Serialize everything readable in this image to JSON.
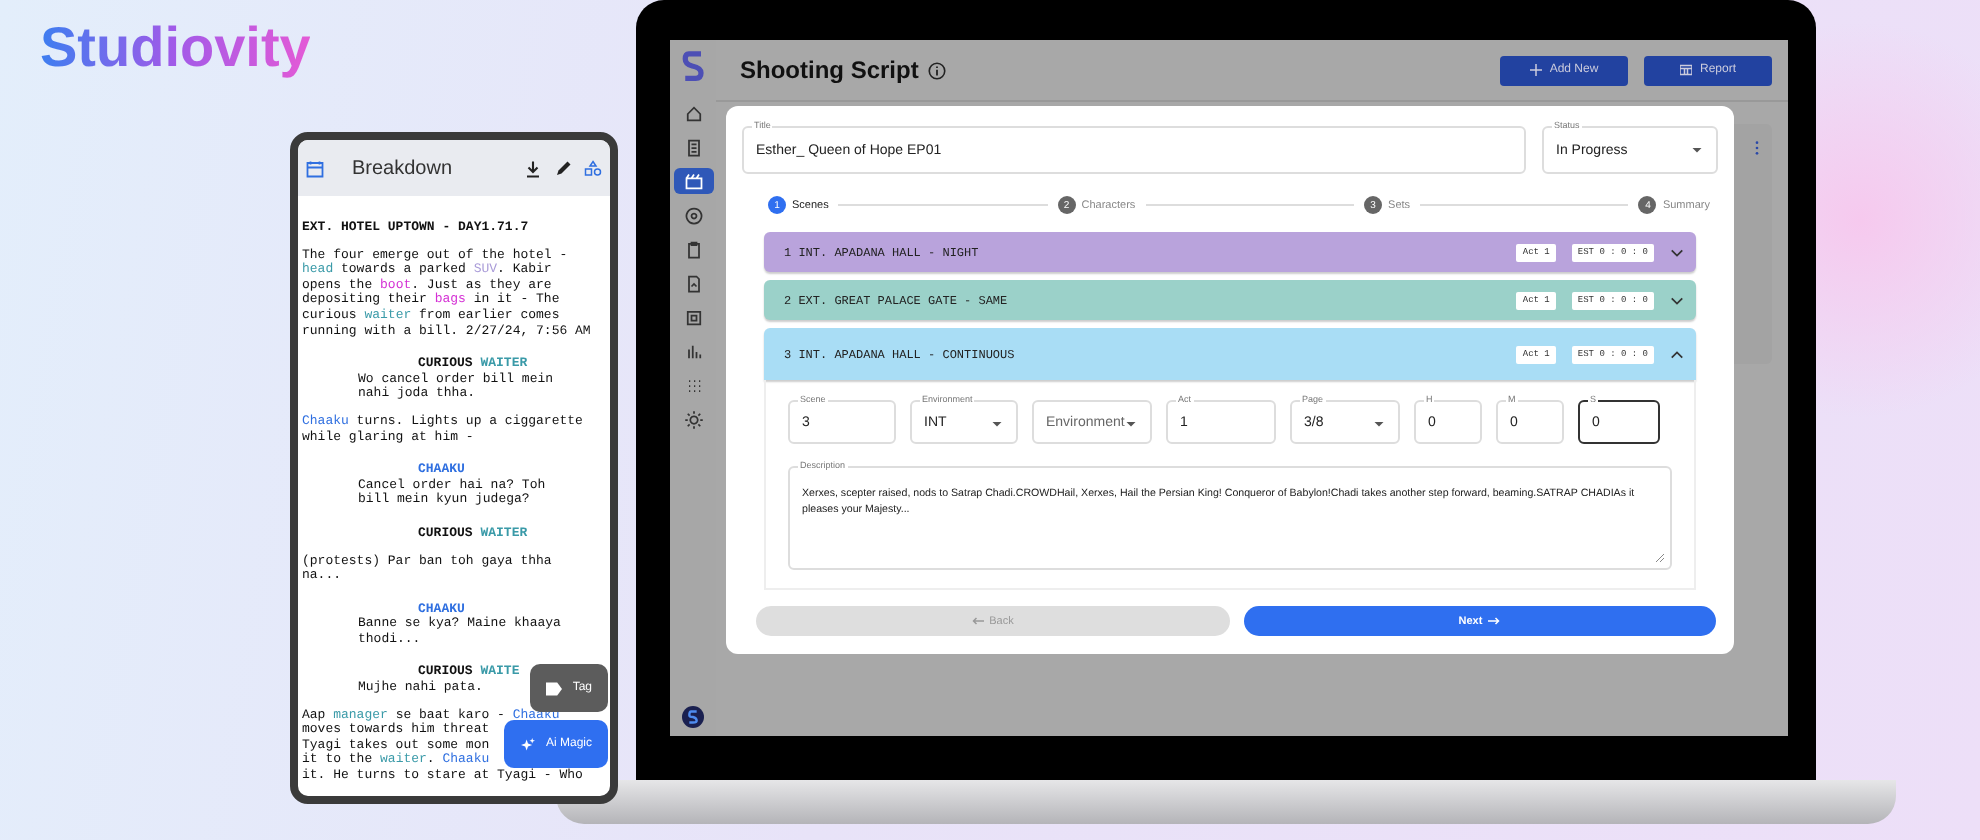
{
  "brand": {
    "name": "Studiovity"
  },
  "phone": {
    "title": "Breakdown",
    "script": [
      {
        "kind": "heading",
        "lines": [
          [
            {
              "text": "EXT. HOTEL UPTOWN - DAY1.71.7"
            }
          ]
        ]
      },
      {
        "kind": "action",
        "lines": [
          [
            {
              "text": "The four emerge out of the hotel -"
            }
          ],
          [
            {
              "text": "head",
              "color": "#3a9aa8"
            },
            {
              "text": " towards a parked "
            },
            {
              "text": "SUV",
              "color": "#a99bd8"
            },
            {
              "text": ". Kabir"
            }
          ],
          [
            {
              "text": "opens the "
            },
            {
              "text": "boot",
              "color": "#d42fd4"
            },
            {
              "text": ". Just as they are"
            }
          ],
          [
            {
              "text": "depositing their "
            },
            {
              "text": "bags",
              "color": "#d42fd4"
            },
            {
              "text": " in it - The"
            }
          ],
          [
            {
              "text": "curious "
            },
            {
              "text": "waiter",
              "color": "#3a9aa8"
            },
            {
              "text": " from earlier comes"
            }
          ],
          [
            {
              "text": "running with a bill. 2/27/24, 7:56 AM"
            }
          ]
        ]
      },
      {
        "kind": "character",
        "lines": [
          [
            {
              "text": "CURIOUS "
            },
            {
              "text": "WAITER",
              "color": "#3a9aa8"
            }
          ]
        ]
      },
      {
        "kind": "dialogue",
        "lines": [
          [
            {
              "text": "Wo cancel order bill mein"
            }
          ],
          [
            {
              "text": "nahi joda thha."
            }
          ]
        ]
      },
      {
        "kind": "action",
        "lines": [
          [
            {
              "text": "Chaaku",
              "color": "#2f6fe0"
            },
            {
              "text": " turns. Lights up a ciggarette"
            }
          ],
          [
            {
              "text": "while glaring at him -"
            }
          ]
        ]
      },
      {
        "kind": "character",
        "lines": [
          [
            {
              "text": "CHAAKU",
              "color": "#2f6fe0"
            }
          ]
        ]
      },
      {
        "kind": "dialogue",
        "lines": [
          [
            {
              "text": "Cancel order hai na? Toh"
            }
          ],
          [
            {
              "text": "bill mein kyun judega?"
            }
          ]
        ]
      },
      {
        "kind": "character",
        "lines": [
          [
            {
              "text": "CURIOUS "
            },
            {
              "text": "WAITER",
              "color": "#3a9aa8"
            }
          ]
        ]
      },
      {
        "kind": "action",
        "lines": [
          [
            {
              "text": "(protests) Par ban toh gaya thha"
            }
          ],
          [
            {
              "text": "na..."
            }
          ]
        ]
      },
      {
        "kind": "character",
        "lines": [
          [
            {
              "text": "CHAAKU",
              "color": "#2f6fe0"
            }
          ]
        ]
      },
      {
        "kind": "dialogue",
        "lines": [
          [
            {
              "text": "Banne se kya? Maine khaaya"
            }
          ],
          [
            {
              "text": "thodi..."
            }
          ]
        ]
      },
      {
        "kind": "character",
        "lines": [
          [
            {
              "text": "CURIOUS "
            },
            {
              "text": "WAITE",
              "color": "#3a9aa8"
            }
          ]
        ]
      },
      {
        "kind": "dialogue",
        "lines": [
          [
            {
              "text": "Mujhe nahi pata."
            }
          ]
        ]
      },
      {
        "kind": "action",
        "lines": [
          [
            {
              "text": "Aap "
            },
            {
              "text": "manager",
              "color": "#3a9aa8"
            },
            {
              "text": " se baat karo - "
            },
            {
              "text": "Chaaku",
              "color": "#2f6fe0"
            }
          ],
          [
            {
              "text": "moves towards him threat"
            }
          ],
          [
            {
              "text": "Tyagi takes out some mon"
            }
          ],
          [
            {
              "text": "it to the "
            },
            {
              "text": "waiter",
              "color": "#3a9aa8"
            },
            {
              "text": ". "
            },
            {
              "text": "Chaaku",
              "color": "#2f6fe0"
            }
          ],
          [
            {
              "text": "it. He turns to stare at Tyagi - Who"
            }
          ]
        ]
      }
    ],
    "buttons": [
      {
        "kind": "tag",
        "label": "Tag"
      },
      {
        "kind": "magic",
        "label": "Ai Magic"
      }
    ]
  },
  "app": {
    "title": "Shooting Script",
    "sidebar": [
      {
        "selected": false
      },
      {
        "selected": false
      },
      {
        "selected": true
      },
      {
        "selected": false
      },
      {
        "selected": false
      },
      {
        "selected": false
      },
      {
        "selected": false
      },
      {
        "selected": false
      },
      {
        "selected": false
      },
      {
        "selected": false
      }
    ],
    "header_buttons": [
      {
        "kind": "add",
        "label": "Add New"
      },
      {
        "kind": "report",
        "label": "Report"
      }
    ],
    "modal": {
      "title_field": {
        "label": "Title",
        "value": "Esther_ Queen of Hope EP01"
      },
      "status_field": {
        "label": "Status",
        "value": "In Progress"
      },
      "steps": [
        {
          "number": "1",
          "label": "Scenes",
          "selected": true
        },
        {
          "number": "2",
          "label": "Characters",
          "selected": false
        },
        {
          "number": "3",
          "label": "Sets",
          "selected": false
        },
        {
          "number": "4",
          "label": "Summary",
          "selected": false
        }
      ],
      "scenes": [
        {
          "heading": "1 INT. APADANA HALL - NIGHT",
          "act": "Act 1",
          "est": "EST 0 : 0 : 0",
          "color": "#b9a3dc",
          "expanded": false
        },
        {
          "heading": "2 EXT. GREAT PALACE GATE - SAME",
          "act": "Act 1",
          "est": "EST 0 : 0 : 0",
          "color": "#9bd1c9",
          "expanded": false
        },
        {
          "heading": "3 INT. APADANA HALL - CONTINUOUS",
          "act": "Act 1",
          "est": "EST 0 : 0 : 0",
          "color": "#a9ddf5",
          "expanded": true
        }
      ],
      "fields": [
        {
          "kind": "text",
          "label": "Scene",
          "value": "3",
          "focused": false
        },
        {
          "kind": "select",
          "label": "Environment",
          "value": "INT",
          "focused": false
        },
        {
          "kind": "select",
          "placeholder": "Environment",
          "focused": false
        },
        {
          "kind": "text",
          "label": "Act",
          "value": "1",
          "focused": false
        },
        {
          "kind": "select",
          "label": "Page",
          "value": "3/8",
          "focused": false
        },
        {
          "kind": "small",
          "label": "H",
          "value": "0",
          "focused": false
        },
        {
          "kind": "small",
          "label": "M",
          "value": "0",
          "focused": false
        },
        {
          "kind": "small",
          "label": "S",
          "value": "0",
          "focused": true
        }
      ],
      "description": {
        "label": "Description",
        "value": "Xerxes, scepter raised, nods to Satrap Chadi.CROWDHail, Xerxes, Hail the Persian King! Conqueror of Babylon!Chadi takes another step forward, beaming.SATRAP CHADIAs it pleases your Majesty..."
      },
      "back": {
        "label": "Back",
        "disabled": true
      },
      "next": {
        "label": "Next",
        "disabled": false
      }
    }
  }
}
